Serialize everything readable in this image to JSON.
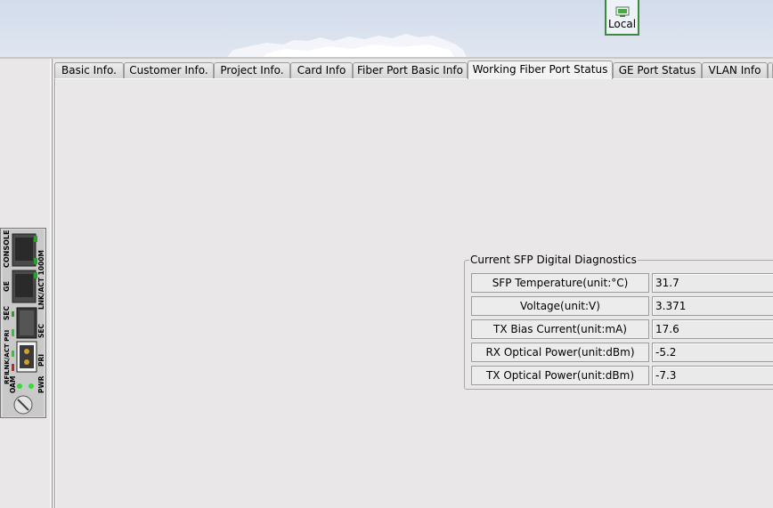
{
  "toolbar": {
    "local_label": "Local"
  },
  "tabs": [
    {
      "label": "Basic Info."
    },
    {
      "label": "Customer Info."
    },
    {
      "label": "Project Info."
    },
    {
      "label": "Card Info"
    },
    {
      "label": "Fiber Port Basic Info"
    },
    {
      "label": "Working Fiber Port Status",
      "active": true
    },
    {
      "label": "GE Port Status"
    },
    {
      "label": "VLAN Info"
    }
  ],
  "card": {
    "labels": {
      "console": "CONSOLE",
      "ge": "GE",
      "lnk_act_1000m": "LNK/ACT 1000M",
      "sec_left": "SEC",
      "sec_right": "SEC",
      "lnk_act_pri": "LNK/ACT PRI",
      "rfi": "RFI",
      "pri": "PRI",
      "oam": "OAM",
      "pwr": "PWR"
    }
  },
  "diagnostics": {
    "title": "Current SFP Digital Diagnostics",
    "rows": [
      {
        "label": "SFP Temperature(unit:°C)",
        "value": "31.7"
      },
      {
        "label": "Voltage(unit:V)",
        "value": "3.371"
      },
      {
        "label": "TX Bias Current(unit:mA)",
        "value": "17.6"
      },
      {
        "label": "RX Optical Power(unit:dBm)",
        "value": "-5.2"
      },
      {
        "label": "TX Optical Power(unit:dBm)",
        "value": "-7.3"
      }
    ]
  },
  "colors": {
    "banner": "#d2dcec",
    "accent_green": "#3c8a3c",
    "led_green": "#33cc33",
    "led_red": "#cc2222",
    "panel_bg": "#e9e7e7"
  }
}
